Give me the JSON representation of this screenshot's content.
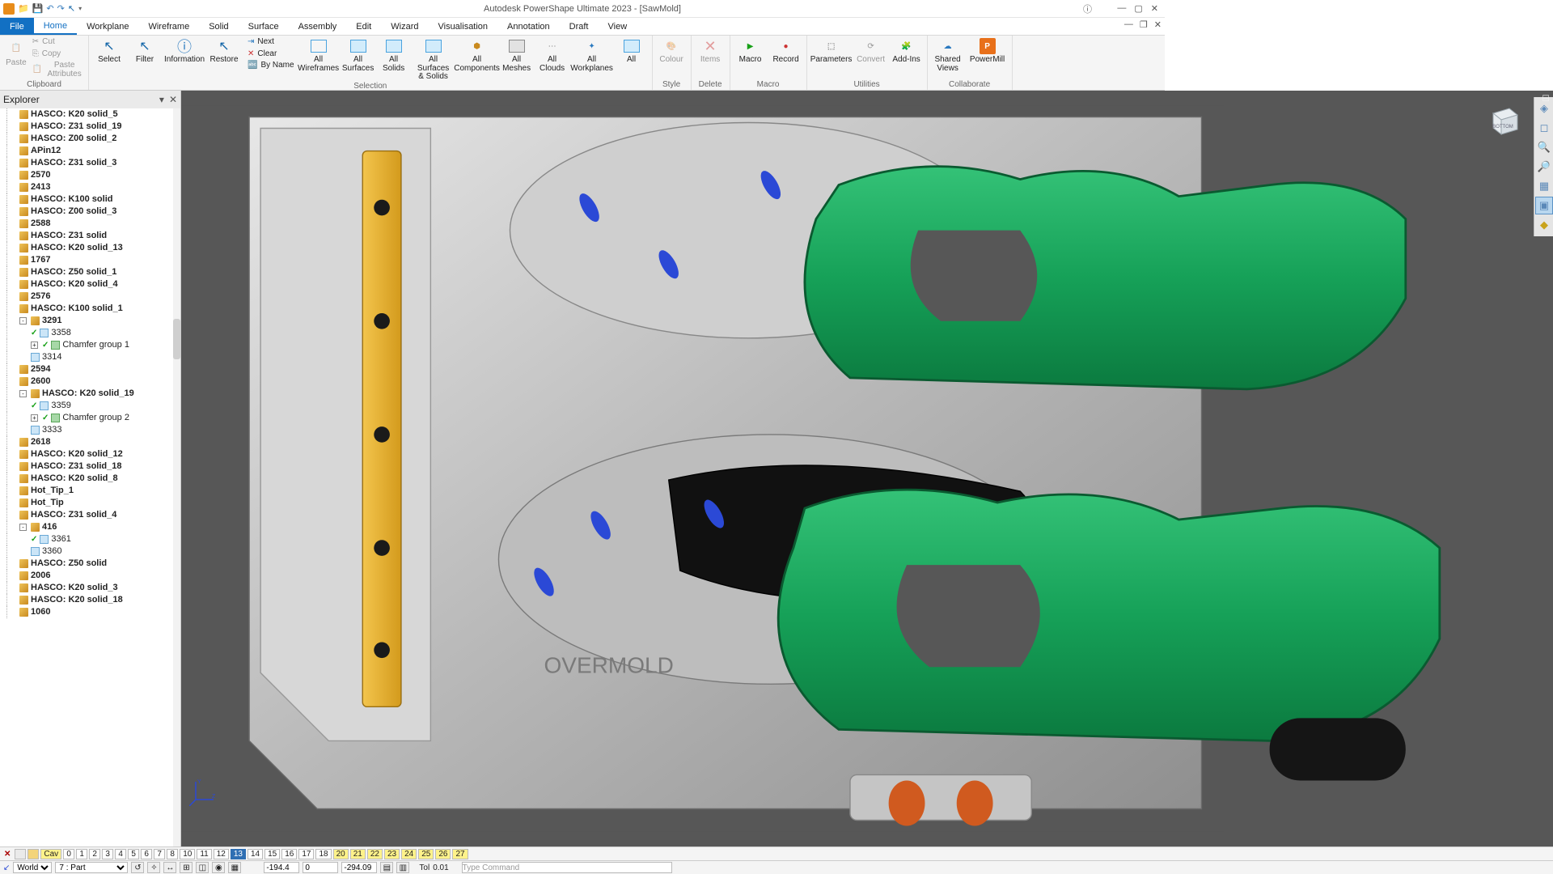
{
  "app": {
    "title": "Autodesk PowerShape Ultimate 2023 - [SawMold]"
  },
  "menus": {
    "file": "File",
    "tabs": [
      "Home",
      "Workplane",
      "Wireframe",
      "Solid",
      "Surface",
      "Assembly",
      "Edit",
      "Wizard",
      "Visualisation",
      "Annotation",
      "Draft",
      "View"
    ],
    "active": "Home"
  },
  "ribbon": {
    "clipboard": {
      "paste": "Paste",
      "cut": "Cut",
      "copy": "Copy",
      "paste_attr": "Paste Attributes",
      "label": "Clipboard"
    },
    "selection": {
      "select": "Select",
      "filter": "Filter",
      "info": "Information",
      "restore": "Restore",
      "next": "Next",
      "clear": "Clear",
      "byname": "By Name",
      "all_wf": "All\nWireframes",
      "all_surf": "All\nSurfaces",
      "all_solids": "All\nSolids",
      "all_ss": "All Surfaces\n& Solids",
      "all_comp": "All\nComponents",
      "all_mesh": "All\nMeshes",
      "all_clouds": "All\nClouds",
      "all_wp": "All\nWorkplanes",
      "all": "All",
      "label": "Selection"
    },
    "style": {
      "colour": "Colour",
      "label": "Style"
    },
    "delete": {
      "items": "Items",
      "label": "Delete"
    },
    "macro": {
      "macro": "Macro",
      "record": "Record",
      "label": "Macro"
    },
    "util": {
      "params": "Parameters",
      "convert": "Convert",
      "addins": "Add-Ins",
      "label": "Utilities"
    },
    "collab": {
      "shared": "Shared\nViews",
      "pmill": "PowerMill",
      "label": "Collaborate"
    }
  },
  "explorer": {
    "title": "Explorer",
    "items": [
      {
        "t": "HASCO: K20 solid_5",
        "b": 1
      },
      {
        "t": "HASCO: Z31 solid_19",
        "b": 1
      },
      {
        "t": "HASCO: Z00 solid_2",
        "b": 1
      },
      {
        "t": "APin12",
        "b": 1
      },
      {
        "t": "HASCO: Z31 solid_3",
        "b": 1
      },
      {
        "t": "2570",
        "b": 1
      },
      {
        "t": "2413",
        "b": 1
      },
      {
        "t": "HASCO: K100 solid",
        "b": 1
      },
      {
        "t": "HASCO: Z00 solid_3",
        "b": 1
      },
      {
        "t": "2588",
        "b": 1
      },
      {
        "t": "HASCO: Z31 solid",
        "b": 1
      },
      {
        "t": "HASCO: K20 solid_13",
        "b": 1
      },
      {
        "t": "1767",
        "b": 1
      },
      {
        "t": "HASCO: Z50 solid_1",
        "b": 1
      },
      {
        "t": "HASCO: K20 solid_4",
        "b": 1
      },
      {
        "t": "2576",
        "b": 1
      },
      {
        "t": "HASCO: K100 solid_1",
        "b": 1
      },
      {
        "t": "3291",
        "b": 1,
        "exp": "-",
        "children": [
          {
            "t": "3358",
            "chk": 1,
            "leaf": 1
          },
          {
            "t": "Chamfer group 1",
            "chk": 1,
            "grp": 1,
            "exp": "+"
          },
          {
            "t": "3314",
            "leaf": 1
          }
        ]
      },
      {
        "t": "2594",
        "b": 1
      },
      {
        "t": "2600",
        "b": 1
      },
      {
        "t": "HASCO: K20 solid_19",
        "b": 1,
        "exp": "-",
        "children": [
          {
            "t": "3359",
            "chk": 1,
            "leaf": 1
          },
          {
            "t": "Chamfer group 2",
            "chk": 1,
            "grp": 1,
            "exp": "+"
          },
          {
            "t": "3333",
            "leaf": 1
          }
        ]
      },
      {
        "t": "2618",
        "b": 1
      },
      {
        "t": "HASCO: K20 solid_12",
        "b": 1
      },
      {
        "t": "HASCO: Z31 solid_18",
        "b": 1
      },
      {
        "t": "HASCO: K20 solid_8",
        "b": 1
      },
      {
        "t": "Hot_Tip_1",
        "b": 1
      },
      {
        "t": "Hot_Tip",
        "b": 1
      },
      {
        "t": "HASCO: Z31 solid_4",
        "b": 1
      },
      {
        "t": "416",
        "b": 1,
        "exp": "-",
        "children": [
          {
            "t": "3361",
            "chk": 1,
            "leaf": 1
          },
          {
            "t": "3360",
            "leaf": 1
          }
        ]
      },
      {
        "t": "HASCO: Z50 solid",
        "b": 1
      },
      {
        "t": "2006",
        "b": 1
      },
      {
        "t": "HASCO: K20 solid_3",
        "b": 1
      },
      {
        "t": "HASCO: K20 solid_18",
        "b": 1
      },
      {
        "t": "1060",
        "b": 1
      }
    ]
  },
  "viewcube": {
    "face": "BOTTOM"
  },
  "viewport_labels": {
    "ovm": "OVERMOLD"
  },
  "layers": {
    "cav": "Cav",
    "nums": [
      "0",
      "1",
      "2",
      "3",
      "4",
      "5",
      "6",
      "7",
      "8",
      "10",
      "11",
      "12",
      "13",
      "14",
      "15",
      "16",
      "17",
      "18",
      "20",
      "21",
      "22",
      "23",
      "24",
      "25",
      "26",
      "27"
    ],
    "yellow": [
      "20",
      "21",
      "22",
      "23",
      "24",
      "25",
      "26",
      "27"
    ],
    "selected": "13"
  },
  "status": {
    "world": "World",
    "principal": "7  : Part",
    "x": "-194.4",
    "y": "0",
    "z": "-294.09",
    "tol_lbl": "Tol",
    "tol": "0.01",
    "cmd_placeholder": "Type Command"
  }
}
